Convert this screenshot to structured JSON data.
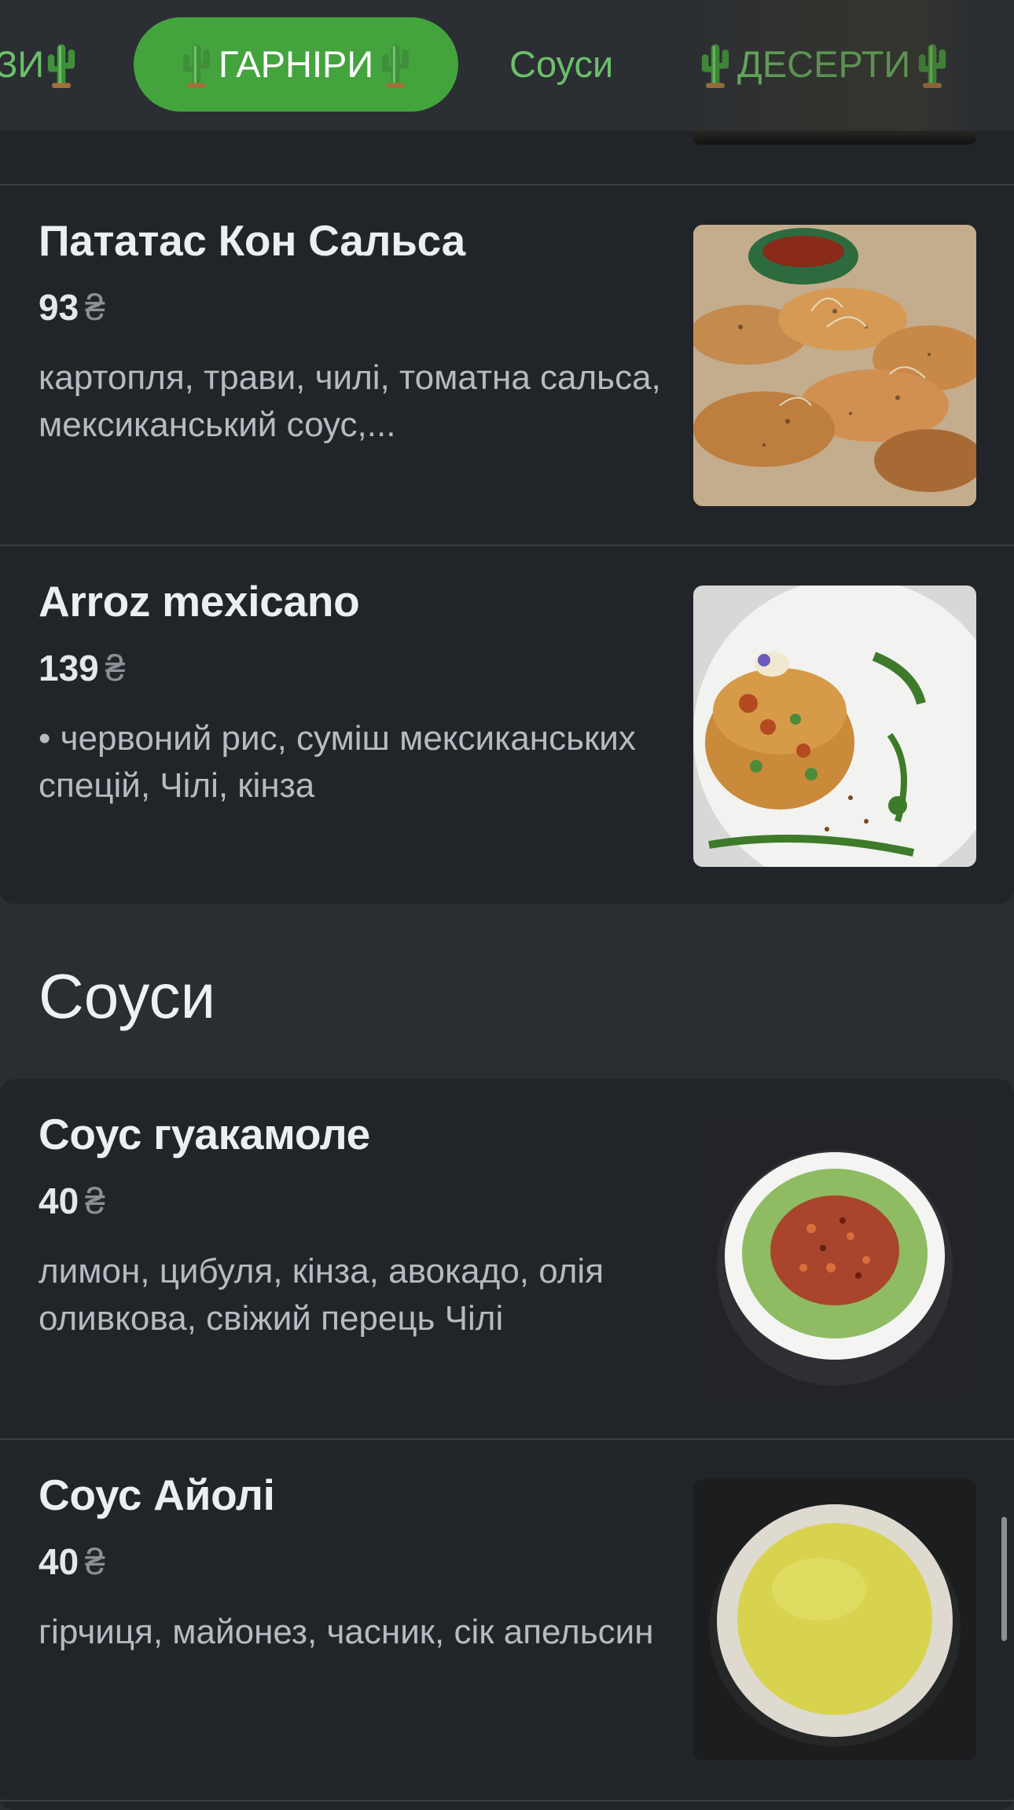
{
  "tabs": [
    {
      "label": "ЗИ",
      "cactus_after": true
    },
    {
      "label": "ГАРНІРИ",
      "active": true
    },
    {
      "label": "Соуси"
    },
    {
      "label": "ДЕСЕРТИ"
    }
  ],
  "icons": {
    "cactus": "cactus-emoji"
  },
  "colors": {
    "accent": "#43a43d",
    "tab_text": "#6cbf6a",
    "card_bg": "#212428",
    "page_bg": "#2a2d32"
  },
  "items": [
    {
      "name": "Пататас Кон Сальса",
      "price": "93",
      "currency": "₴",
      "desc": "картопля, трави, чилі, томатна сальса, мексиканський соус,..."
    },
    {
      "name": "Arroz mexicano",
      "price": "139",
      "currency": "₴",
      "desc": "• червоний рис, суміш мексиканських спецій, Чілі, кінза"
    }
  ],
  "sauces_section": {
    "title": "Соуси"
  },
  "sauces": [
    {
      "name": "Соус гуакамоле",
      "price": "40",
      "currency": "₴",
      "desc": "лимон, цибуля, кінза, авокадо, олія оливкова, свіжий перець Чілі"
    },
    {
      "name": "Соус Айолі",
      "price": "40",
      "currency": "₴",
      "desc": "гірчиця, майонез, часник, сік апельсин"
    }
  ]
}
